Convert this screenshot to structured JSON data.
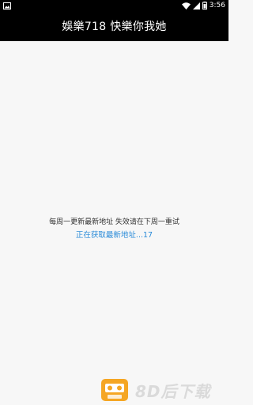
{
  "status_bar": {
    "time": "3:56",
    "icons": [
      "image-icon",
      "wifi-icon",
      "signal-icon",
      "battery-icon"
    ]
  },
  "header": {
    "title": "娛樂718 快樂你我她"
  },
  "main": {
    "notice": "每周一更新最新地址 失效请在下周一重试",
    "progress_text": "正在获取最新地址...17"
  },
  "watermark": {
    "text": "8D后下载",
    "icon": "cassette-logo-icon"
  },
  "colors": {
    "title_bar": "#000000",
    "background": "#f7f7f7",
    "progress_text": "#2a8bd8",
    "notice_text": "#333333",
    "watermark_logo": "#f5a623"
  }
}
